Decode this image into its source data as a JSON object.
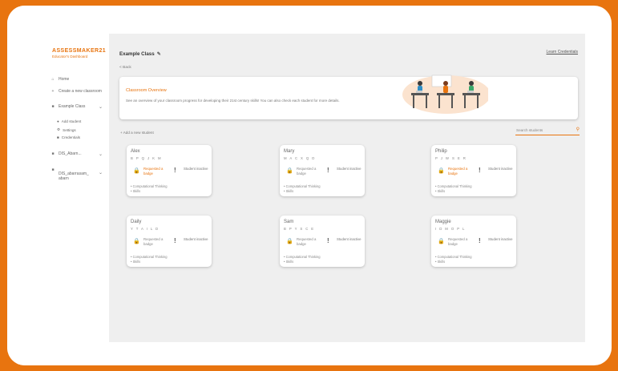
{
  "brand": {
    "title": "ASSESSMAKER21",
    "subtitle": "Educator's Dashboard"
  },
  "sidebar": {
    "home": "Home",
    "create": "Create a new classroom",
    "classes": [
      {
        "label": "Example Class",
        "subitems": [
          "Add student",
          "Settings",
          "Credentials"
        ]
      },
      {
        "label": "DIS_Abarn...",
        "subitems": []
      },
      {
        "label": "DIS_abarrasam_abarn",
        "subitems": []
      }
    ]
  },
  "header": {
    "class_title": "Example Class",
    "back": "< Back",
    "learn": "Learn Credentials"
  },
  "overview": {
    "title": "Classroom Overview",
    "text": "See an overview of your classroom progress for developing their 21st century skills! You can also check each student for more details."
  },
  "toolbar": {
    "add_student": "+ Add a new student",
    "search_placeholder": "Search students"
  },
  "students": [
    {
      "name": "Alex",
      "code": "B P Q J K M",
      "badge": "Requested a badge",
      "badge_state": "requested",
      "status": "Student inactive",
      "skills": [
        "Computational Thinking",
        "Skills"
      ]
    },
    {
      "name": "Mary",
      "code": "M A C X Q D",
      "badge": "Requested a badge",
      "badge_state": "none",
      "status": "Student inactive",
      "skills": [
        "Computational Thinking",
        "Skills"
      ]
    },
    {
      "name": "Philip",
      "code": "P J W S E R",
      "badge": "Requested a badge",
      "badge_state": "requested",
      "status": "Student inactive",
      "skills": [
        "Computational Thinking",
        "Skills"
      ]
    },
    {
      "name": "Daily",
      "code": "Y T A I L D",
      "badge": "Requested a badge",
      "badge_state": "none",
      "status": "Student inactive",
      "skills": [
        "Computational Thinking",
        "Skills"
      ]
    },
    {
      "name": "Sam",
      "code": "B P Y S C E",
      "badge": "Requested a badge",
      "badge_state": "none",
      "status": "Student inactive",
      "skills": [
        "Computational Thinking",
        "Skills"
      ]
    },
    {
      "name": "Maggie",
      "code": "I D M O P L",
      "badge": "Requested a badge",
      "badge_state": "none",
      "status": "Student inactive",
      "skills": [
        "Computational Thinking",
        "Skills"
      ]
    }
  ],
  "colors": {
    "accent": "#e8740f",
    "background": "#efefef"
  }
}
